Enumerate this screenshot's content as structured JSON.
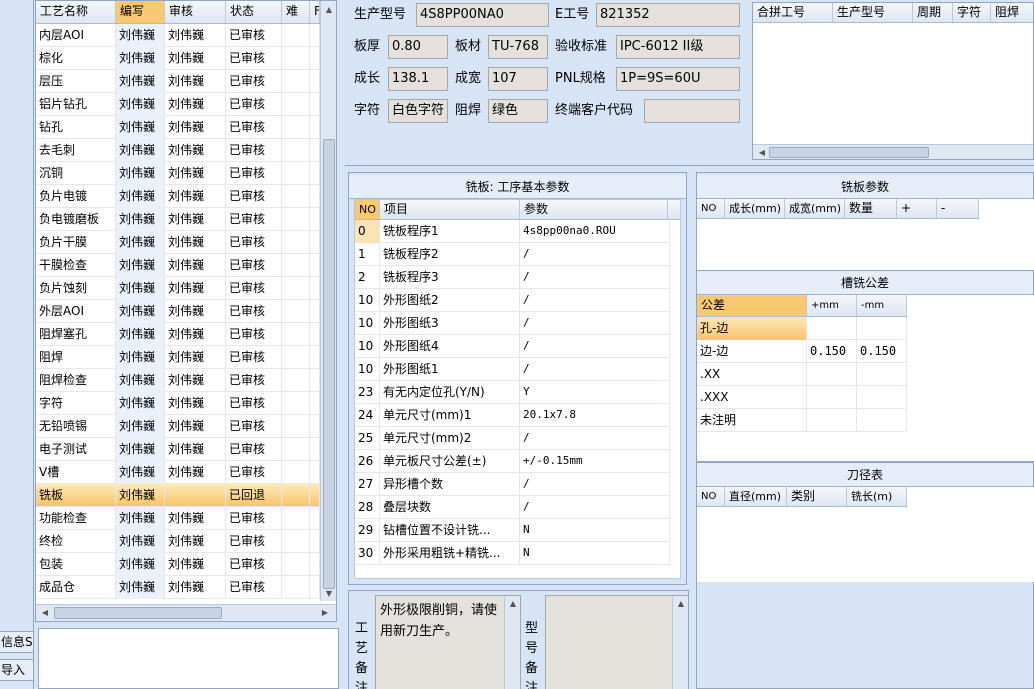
{
  "process_table": {
    "headers": [
      "工艺名称",
      "编写",
      "审核",
      "状态",
      "难",
      "F"
    ],
    "rows": [
      {
        "name": "内层AOI",
        "author": "刘伟巍",
        "reviewer": "刘伟巍",
        "status": "已审核"
      },
      {
        "name": "棕化",
        "author": "刘伟巍",
        "reviewer": "刘伟巍",
        "status": "已审核"
      },
      {
        "name": "层压",
        "author": "刘伟巍",
        "reviewer": "刘伟巍",
        "status": "已审核"
      },
      {
        "name": "铝片钻孔",
        "author": "刘伟巍",
        "reviewer": "刘伟巍",
        "status": "已审核"
      },
      {
        "name": "钻孔",
        "author": "刘伟巍",
        "reviewer": "刘伟巍",
        "status": "已审核"
      },
      {
        "name": "去毛刺",
        "author": "刘伟巍",
        "reviewer": "刘伟巍",
        "status": "已审核"
      },
      {
        "name": "沉铜",
        "author": "刘伟巍",
        "reviewer": "刘伟巍",
        "status": "已审核"
      },
      {
        "name": "负片电镀",
        "author": "刘伟巍",
        "reviewer": "刘伟巍",
        "status": "已审核"
      },
      {
        "name": "负电镀磨板",
        "author": "刘伟巍",
        "reviewer": "刘伟巍",
        "status": "已审核"
      },
      {
        "name": "负片干膜",
        "author": "刘伟巍",
        "reviewer": "刘伟巍",
        "status": "已审核"
      },
      {
        "name": "干膜检查",
        "author": "刘伟巍",
        "reviewer": "刘伟巍",
        "status": "已审核"
      },
      {
        "name": "负片蚀刻",
        "author": "刘伟巍",
        "reviewer": "刘伟巍",
        "status": "已审核"
      },
      {
        "name": "外层AOI",
        "author": "刘伟巍",
        "reviewer": "刘伟巍",
        "status": "已审核"
      },
      {
        "name": "阻焊塞孔",
        "author": "刘伟巍",
        "reviewer": "刘伟巍",
        "status": "已审核"
      },
      {
        "name": "阻焊",
        "author": "刘伟巍",
        "reviewer": "刘伟巍",
        "status": "已审核"
      },
      {
        "name": "阻焊检查",
        "author": "刘伟巍",
        "reviewer": "刘伟巍",
        "status": "已审核"
      },
      {
        "name": "字符",
        "author": "刘伟巍",
        "reviewer": "刘伟巍",
        "status": "已审核"
      },
      {
        "name": "无铅喷锡",
        "author": "刘伟巍",
        "reviewer": "刘伟巍",
        "status": "已审核"
      },
      {
        "name": "电子测试",
        "author": "刘伟巍",
        "reviewer": "刘伟巍",
        "status": "已审核"
      },
      {
        "name": "V槽",
        "author": "刘伟巍",
        "reviewer": "刘伟巍",
        "status": "已审核"
      },
      {
        "name": "铣板",
        "author": "刘伟巍",
        "reviewer": "",
        "status": "已回退"
      },
      {
        "name": "功能检查",
        "author": "刘伟巍",
        "reviewer": "刘伟巍",
        "status": "已审核"
      },
      {
        "name": "终检",
        "author": "刘伟巍",
        "reviewer": "刘伟巍",
        "status": "已审核"
      },
      {
        "name": "包装",
        "author": "刘伟巍",
        "reviewer": "刘伟巍",
        "status": "已审核"
      },
      {
        "name": "成品仓",
        "author": "刘伟巍",
        "reviewer": "刘伟巍",
        "status": "已审核"
      }
    ],
    "selected_index": 20
  },
  "left_buttons": {
    "info": "信息S",
    "import": "导入"
  },
  "info": {
    "product_model_label": "生产型号",
    "product_model": "4S8PP00NA0",
    "e_no_label": "E工号",
    "e_no": "821352",
    "thickness_label": "板厚",
    "thickness": "0.80",
    "material_label": "板材",
    "material": "TU-768",
    "standard_label": "验收标准",
    "standard": "IPC-6012 II级",
    "length_label": "成长",
    "length": "138.1",
    "width_label": "成宽",
    "width": "107",
    "pnl_label": "PNL规格",
    "pnl": "1P=9S=60U",
    "char_label": "字符",
    "char": "白色字符",
    "solder_label": "阻焊",
    "solder": "绿色",
    "customer_label": "终端客户代码",
    "customer": ""
  },
  "merge_table": {
    "headers": [
      "合拼工号",
      "生产型号",
      "周期",
      "字符",
      "阻焊"
    ]
  },
  "params": {
    "title": "铣板: 工序基本参数",
    "headers": [
      "NO",
      "项目",
      "参数"
    ],
    "rows": [
      {
        "no": "0",
        "item": "铣板程序1",
        "value": "4s8pp00na0.ROU"
      },
      {
        "no": "1",
        "item": "铣板程序2",
        "value": "/"
      },
      {
        "no": "2",
        "item": "铣板程序3",
        "value": "/"
      },
      {
        "no": "10",
        "item": "外形图纸2",
        "value": "/"
      },
      {
        "no": "10",
        "item": "外形图纸3",
        "value": "/"
      },
      {
        "no": "10",
        "item": "外形图纸4",
        "value": "/"
      },
      {
        "no": "10",
        "item": "外形图纸1",
        "value": "/"
      },
      {
        "no": "23",
        "item": "有无内定位孔(Y/N)",
        "value": "Y"
      },
      {
        "no": "24",
        "item": "单元尺寸(mm)1",
        "value": "20.1x7.8"
      },
      {
        "no": "25",
        "item": "单元尺寸(mm)2",
        "value": "/"
      },
      {
        "no": "26",
        "item": "单元板尺寸公差(±)",
        "value": "+/-0.15mm"
      },
      {
        "no": "27",
        "item": "异形槽个数",
        "value": "/"
      },
      {
        "no": "28",
        "item": "叠层块数",
        "value": "/"
      },
      {
        "no": "29",
        "item": "钻槽位置不设计铣...",
        "value": "N"
      },
      {
        "no": "30",
        "item": "外形采用粗铣+精铣...",
        "value": "N"
      }
    ]
  },
  "mill_params": {
    "title": "铣板参数",
    "headers": [
      "NO",
      "成长(mm)",
      "成宽(mm)",
      "数量",
      "+",
      "-"
    ]
  },
  "slot_tol": {
    "title": "槽铣公差",
    "headers": [
      "公差",
      "+mm",
      "-mm"
    ],
    "rows": [
      {
        "name": "孔-边",
        "plus": "",
        "minus": ""
      },
      {
        "name": "边-边",
        "plus": "0.150",
        "minus": "0.150"
      },
      {
        "name": ".XX",
        "plus": "",
        "minus": ""
      },
      {
        "name": ".XXX",
        "plus": "",
        "minus": ""
      },
      {
        "name": "未注明",
        "plus": "",
        "minus": ""
      }
    ]
  },
  "tool_table": {
    "title": "刀径表",
    "headers": [
      "NO",
      "直径(mm)",
      "类别",
      "铣长(m)"
    ]
  },
  "notes": {
    "process_label": "工艺备注",
    "process_text": "外形极限削铜，请使用新刀生产。",
    "model_label": "型号备注",
    "model_text": ""
  }
}
